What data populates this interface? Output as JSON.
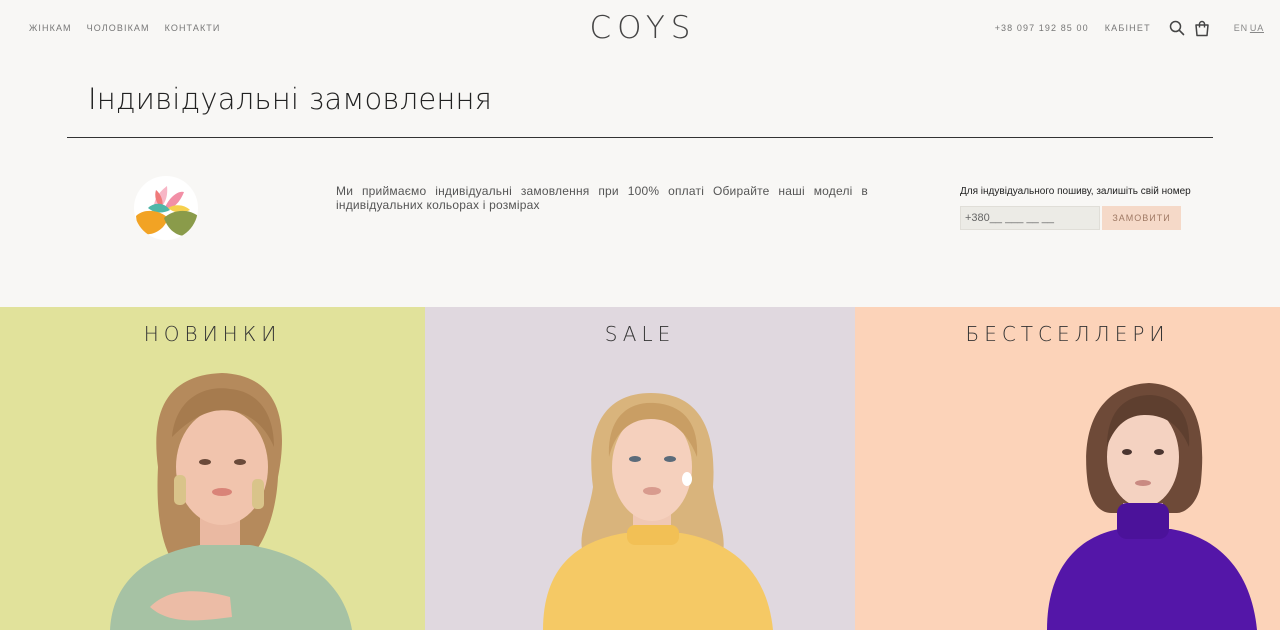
{
  "header": {
    "nav_left": [
      {
        "label": "ЖІНКАМ"
      },
      {
        "label": "ЧОЛОВІКАМ"
      },
      {
        "label": "КОНТАКТИ"
      }
    ],
    "logo": "COYS",
    "phone": "+38 097 192 85 00",
    "cabinet": "КАБІНЕТ",
    "languages": [
      "EN",
      "UA"
    ],
    "active_language": "UA"
  },
  "page": {
    "title": "Індивідуальні замовлення",
    "info_text": "Ми приймаємо індивідуальні замовлення при 100% оплаті Обирайте наші моделі в індивідуальних кольорах і розмірах",
    "order_form": {
      "label": "Для індувідуального пошиву, залишіть свій номер",
      "phone_placeholder": "+380__ ___ __ __",
      "button": "ЗАМОВИТИ"
    }
  },
  "categories": [
    {
      "title": "НОВИНКИ",
      "bg": "#e1e29b"
    },
    {
      "title": "SALE",
      "bg": "#e0d8df"
    },
    {
      "title": "БЕСТСЕЛЛЕРИ",
      "bg": "#fcd3b9"
    }
  ],
  "colors": {
    "background": "#f8f7f5",
    "button_bg": "#f5d9c8",
    "button_text": "#a07a65"
  }
}
